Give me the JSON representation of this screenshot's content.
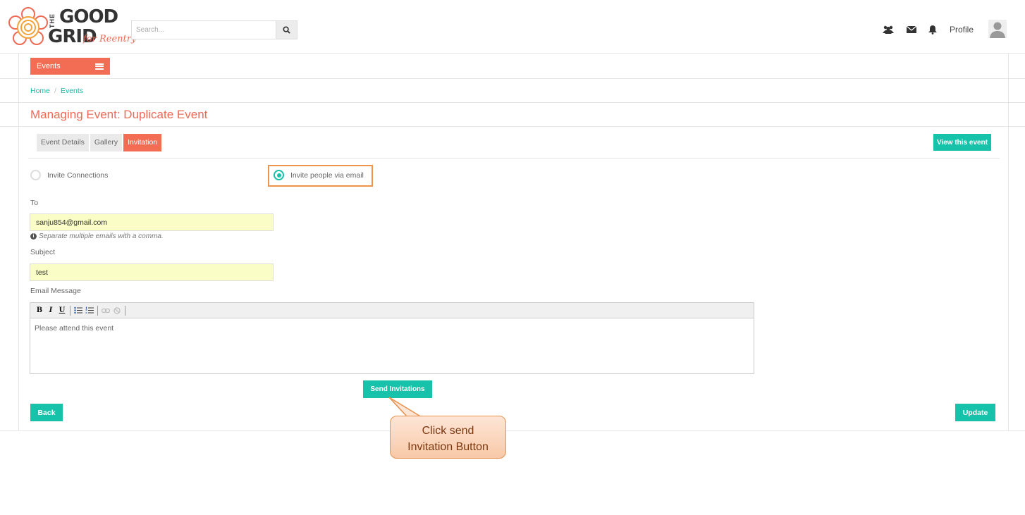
{
  "brand": {
    "logo_the": "THE",
    "logo_good": "GOOD",
    "logo_grid": "GRID",
    "logo_tagline": "for Reentry",
    "accent_color": "#f36c54",
    "teal_color": "#16c2a9"
  },
  "header": {
    "search_placeholder": "Search...",
    "search_icon": "search-icon",
    "icons": [
      "users-icon",
      "envelope-icon",
      "bell-icon"
    ],
    "profile_label": "Profile",
    "avatar_icon": "user-avatar-icon"
  },
  "nav": {
    "events_menu_label": "Events"
  },
  "breadcrumb": {
    "home": "Home",
    "separator": "/",
    "current": "Events"
  },
  "page": {
    "title": "Managing Event: Duplicate Event"
  },
  "tabs": [
    {
      "label": "Event Details",
      "active": false
    },
    {
      "label": "Gallery",
      "active": false
    },
    {
      "label": "Invitation",
      "active": true
    }
  ],
  "actions": {
    "view_event_label": "View this event",
    "send_invitations_label": "Send Invitations",
    "back_label": "Back",
    "update_label": "Update"
  },
  "invite_options": {
    "connections_label": "Invite Connections",
    "email_label": "Invite people via email",
    "selected": "Invite people via email"
  },
  "form": {
    "to_label": "To",
    "to_value": "sanju854@gmail.com",
    "to_help": "Separate multiple emails with a comma.",
    "subject_label": "Subject",
    "subject_value": "test",
    "message_label": "Email Message",
    "message_value": "Please attend this event",
    "toolbar": {
      "bold": "B",
      "italic": "I",
      "underline": "U"
    }
  },
  "annotation": {
    "callout_line1": "Click send",
    "callout_line2": "Invitation Button"
  }
}
